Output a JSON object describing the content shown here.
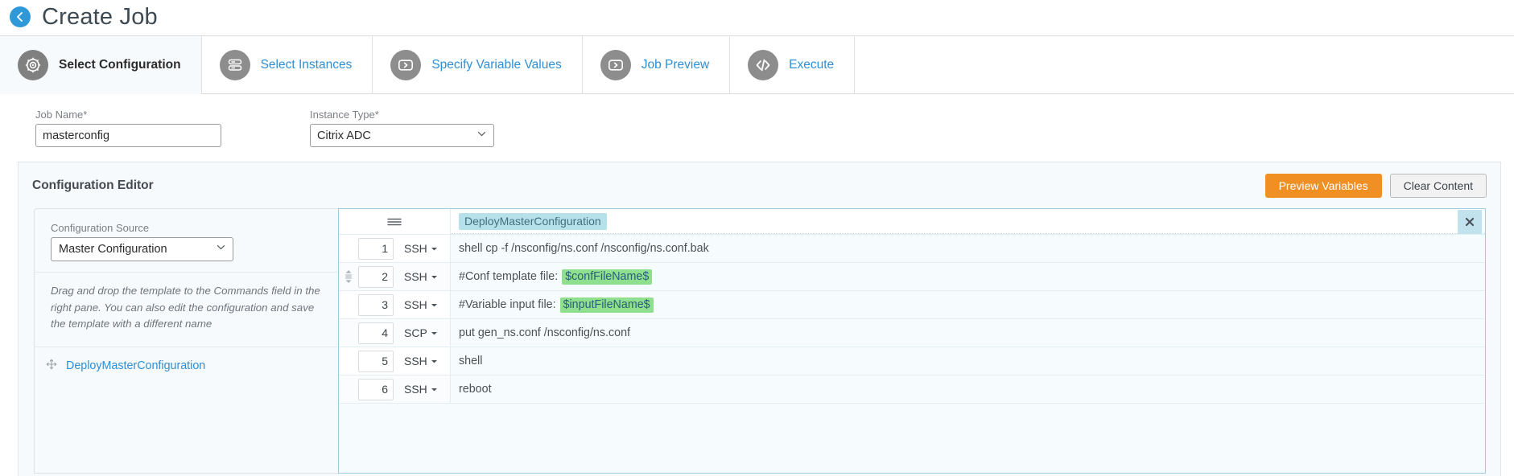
{
  "header": {
    "back_icon": "back-arrow-icon",
    "title": "Create Job"
  },
  "tabs": [
    {
      "label": "Select Configuration",
      "icon": "gear-icon",
      "active": true
    },
    {
      "label": "Select Instances",
      "icon": "server-stack-icon",
      "active": false
    },
    {
      "label": "Specify Variable Values",
      "icon": "chevron-box-icon",
      "active": false
    },
    {
      "label": "Job Preview",
      "icon": "chevron-box-icon",
      "active": false
    },
    {
      "label": "Execute",
      "icon": "code-icon",
      "active": false
    }
  ],
  "form": {
    "job_name": {
      "label": "Job Name*",
      "value": "masterconfig",
      "placeholder": ""
    },
    "instance_type": {
      "label": "Instance Type*",
      "value": "Citrix ADC",
      "caret_icon": "chevron-down-icon"
    }
  },
  "config_editor": {
    "title": "Configuration Editor",
    "preview_variables_label": "Preview Variables",
    "clear_content_label": "Clear Content",
    "primary_color": "#ef8f24"
  },
  "source_pane": {
    "label": "Configuration Source",
    "selected": "Master Configuration",
    "caret_icon": "chevron-down-icon",
    "hint": "Drag and drop the template to the Commands field in the right pane. You can also edit the configuration and save the template with a different name",
    "items": [
      {
        "label": "DeployMasterConfiguration",
        "icon": "move-handle-icon"
      }
    ]
  },
  "command_pane": {
    "menu_icon": "hamburger-menu-icon",
    "template_tag": "DeployMasterConfiguration",
    "close_icon": "close-icon",
    "rows": [
      {
        "num": "1",
        "protocol": "SSH",
        "text": "shell cp -f /nsconfig/ns.conf /nsconfig/ns.conf.bak",
        "token": "",
        "handle": false
      },
      {
        "num": "2",
        "protocol": "SSH",
        "text": "#Conf template file:",
        "token": "$confFileName$",
        "handle": true
      },
      {
        "num": "3",
        "protocol": "SSH",
        "text": "#Variable input file:",
        "token": "$inputFileName$",
        "handle": false
      },
      {
        "num": "4",
        "protocol": "SCP",
        "text": "put gen_ns.conf /nsconfig/ns.conf",
        "token": "",
        "handle": false
      },
      {
        "num": "5",
        "protocol": "SSH",
        "text": "shell",
        "token": "",
        "handle": false
      },
      {
        "num": "6",
        "protocol": "SSH",
        "text": "reboot",
        "token": "",
        "handle": false
      }
    ]
  }
}
